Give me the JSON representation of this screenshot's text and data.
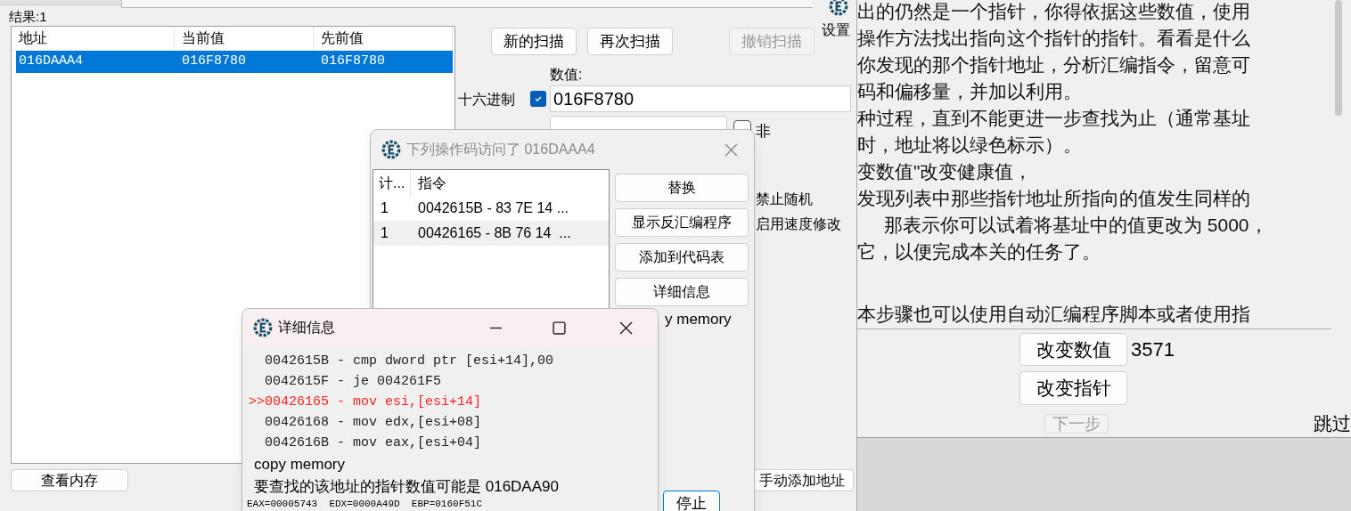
{
  "main_window": {
    "result_label": "结果:1",
    "table": {
      "columns": [
        "地址",
        "当前值",
        "先前值"
      ],
      "rows": [
        {
          "cells": [
            "016DAAA4",
            "016F8780",
            "016F8780"
          ],
          "selected": true
        }
      ]
    },
    "scan_buttons": [
      {
        "label": "新的扫描",
        "disabled": false
      },
      {
        "label": "再次扫描",
        "disabled": false
      },
      {
        "label": "撤销扫描",
        "disabled": true
      }
    ],
    "value_label": "数值:",
    "hex_label": "十六进制",
    "hex_checked": true,
    "value": "016F8780",
    "not_label": "非",
    "not_checked": false,
    "options": [
      "禁止随机",
      "启用速度修改"
    ],
    "view_memory_button": "查看内存",
    "add_address_button": "手动添加地址",
    "stop_button": "停止",
    "settings_label": "设置"
  },
  "tutorial": {
    "lines": [
      "出的仍然是一个指针，你得依据这些数值，使用",
      "操作方法找出指向这个指针的指针。看看是什么",
      "你发现的那个指针地址，分析汇编指令，留意可",
      "码和偏移量，并加以利用。",
      "种过程，直到不能更进一步查找为止（通常基址",
      "时，地址将以绿色标示）。",
      "变数值\"改变健康值，",
      "发现列表中那些指针地址所指向的值发生同样的",
      "那表示你可以试着将基址中的值更改为 5000，",
      "它，以便完成本关的任务了。",
      "本步骤也可以使用自动汇编程序脚本或者使用指"
    ],
    "change_value_button": "改变数值",
    "value": "3571",
    "change_pointer_button": "改变指针",
    "next_button": {
      "label": "下一步",
      "disabled": true
    },
    "skip_label": "跳过"
  },
  "opcode_dialog": {
    "title": "下列操作码访问了 016DAAA4",
    "columns": [
      "计...",
      "指令"
    ],
    "rows": [
      {
        "count": "1",
        "instruction": "0042615B - 83 7E 14 ...",
        "selected": false
      },
      {
        "count": "1",
        "instruction": "00426165 - 8B 76 14  ...",
        "selected": true
      }
    ],
    "buttons": [
      "替换",
      "显示反汇编程序",
      "添加到代码表",
      "详细信息"
    ],
    "partial_text": "y memory"
  },
  "details_window": {
    "title": "详细信息",
    "code": [
      {
        "text": "0042615B - cmp dword ptr [esi+14],00",
        "current": false
      },
      {
        "text": "0042615F - je 004261F5",
        "current": false
      },
      {
        "marker": ">>",
        "text": "00426165 - mov esi,[esi+14]",
        "current": true
      },
      {
        "text": "00426168 - mov edx,[esi+08]",
        "current": false
      },
      {
        "text": "0042616B - mov eax,[esi+04]",
        "current": false
      }
    ],
    "copy_memory": "copy memory",
    "pointer_note": "要查找的该地址的指针数值可能是 016DAA90",
    "registers": "EAX=00005743  EDX=0000A49D  EBP=0160F51C"
  }
}
